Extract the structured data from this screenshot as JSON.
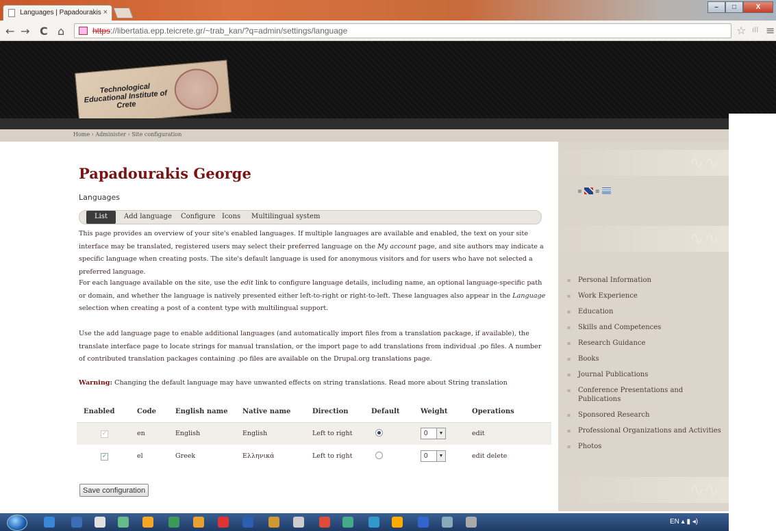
{
  "browser": {
    "tab_title": "Languages | Papadourakis",
    "tab_close": "×",
    "url_protocol": "https",
    "url_rest": "://libertatia.epp.teicrete.gr/~trab_kan/?q=admin/settings/language",
    "nav_back": "←",
    "nav_forward": "→",
    "nav_reload": "C",
    "nav_home": "⌂",
    "star": "☆",
    "signal": "ıll",
    "menu": "≡",
    "win_min": "–",
    "win_max": "□",
    "win_close": "X"
  },
  "header": {
    "logo_text": "Technological Educational Institute of Crete"
  },
  "breadcrumb": "Home › Administer › Site configuration",
  "page": {
    "title": "Papadourakis George",
    "section_label": "Languages",
    "tabs": [
      {
        "label": "List"
      },
      {
        "label": "Add language"
      },
      {
        "label": "Configure"
      },
      {
        "label": "Icons"
      },
      {
        "label": "Multilingual system"
      }
    ],
    "para1_a": "This page provides an overview of your site's enabled languages. If multiple languages are available and enabled, the text on your site interface may be translated, registered users may select their preferred language on the ",
    "para1_em": "My account",
    "para1_b": " page, and site authors may indicate a specific language when creating posts. The site's default language is used for anonymous visitors and for users who have not selected a preferred language.",
    "para2_a": "For each language available on the site, use the ",
    "para2_em": "edit",
    "para2_b": " link to configure language details, including name, an optional language-specific path or domain, and whether the language is natively presented either left-to-right or right-to-left. These languages also appear in the ",
    "para2_em2": "Language",
    "para2_c": " selection when creating a post of a content type with multilingual support.",
    "para3": "Use the add language page to enable additional languages (and automatically import files from a translation package, if available), the translate interface page to locate strings for manual translation, or the import page to add translations from individual .po files. A number of contributed translation packages containing .po files are available on the Drupal.org translations page.",
    "warning_label": "Warning:",
    "warning_text": " Changing the default language may have unwanted effects on string translations. Read more about String translation",
    "save_label": "Save configuration"
  },
  "table": {
    "headers": [
      "Enabled",
      "Code",
      "English name",
      "Native name",
      "Direction",
      "Default",
      "Weight",
      "Operations"
    ],
    "rows": [
      {
        "enabled": true,
        "enabled_locked": true,
        "code": "en",
        "english": "English",
        "native": "English",
        "direction": "Left to right",
        "default": true,
        "weight": "0",
        "operations": "edit"
      },
      {
        "enabled": true,
        "enabled_locked": false,
        "code": "el",
        "english": "Greek",
        "native": "Ελληνικά",
        "direction": "Left to right",
        "default": false,
        "weight": "0",
        "operations": "edit delete"
      }
    ]
  },
  "sidebar": {
    "flags_sep": "▪",
    "menu": [
      "Personal Information",
      "Work Experience",
      "Education",
      "Skills and Competences",
      "Research Guidance",
      "Books",
      "Journal Publications",
      "Conference Presentations and Publications",
      "Sponsored Research",
      "Professional Organizations and Activities",
      "Photos"
    ]
  },
  "taskbar": {
    "tray_text": "EN"
  },
  "colors": {
    "brand_red": "#7a1414",
    "header_dark": "#121212",
    "sidebar_bg": "#dcd5cb"
  }
}
